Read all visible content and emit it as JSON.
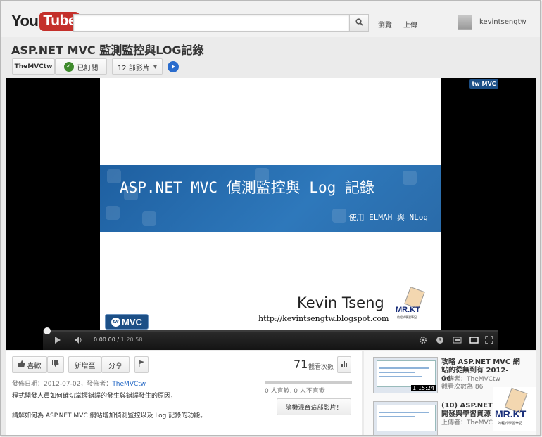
{
  "header": {
    "logo_you": "You",
    "logo_tube": "Tube",
    "search_placeholder": "",
    "nav_browse": "瀏覽",
    "nav_upload": "上傳",
    "username": "kevintsengtw"
  },
  "video": {
    "title": "ASP.NET MVC 監測監控與LOG記錄",
    "channel": "TheMVCtw",
    "subscribed_label": "已訂閱",
    "videos_label": "12 部影片"
  },
  "slide": {
    "title": "ASP.NET MVC 偵測監控與 Log 記錄",
    "subtitle": "使用 ELMAH 與 NLog",
    "author": "Kevin Tseng",
    "url": "http://kevintsengtw.blogspot.com",
    "mrkt": "MR.KT",
    "mrkt_sub": "的程式學習筆記",
    "twmvc": "MVC",
    "tw": "tw"
  },
  "player": {
    "current_time": "0:00:00",
    "duration": "1:20:58",
    "progress": 0
  },
  "actions": {
    "like_label": "喜歡",
    "addto_label": "新增至",
    "share_label": "分享",
    "view_count": "71",
    "view_label": "觀看次數",
    "like_dislike": "0 人喜歡, 0 人不喜歡",
    "publish_info_prefix": "發佈日期：2012-07-02，發佈者：",
    "publish_channel": "TheMVCtw",
    "description_1": "程式開發人員如何確切掌握錯誤的發生與錯誤發生的原因，",
    "description_2": "請解如何為 ASP.NET MVC 網站增加偵測監控以及 Log 記錄的功能。",
    "remix_label": "隨機混合這部影片！"
  },
  "related": [
    {
      "title_line1": "攻略 ASP.NET MVC 網",
      "title_line2": "站的從無到有 2012-06-",
      "uploader": "上傳者：TheMVCtw",
      "views": "觀看次數為 86",
      "duration": "1:15:24"
    },
    {
      "title_line1": "(10) ASP.NET M",
      "title_line2": "開發與學習資源",
      "uploader": "上傳者：TheMVC",
      "views": "",
      "duration": ""
    }
  ],
  "colors": {
    "brand_red": "#c4302b",
    "link_blue": "#2569c5",
    "slide_blue": "#2e78bb"
  }
}
